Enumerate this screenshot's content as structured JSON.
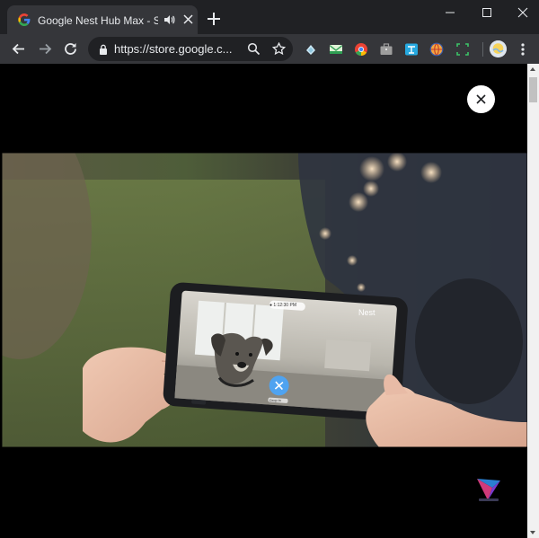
{
  "tab": {
    "title": "Google Nest Hub Max - Sm",
    "favicon": "google-g-icon",
    "audio_icon": "speaker-icon",
    "close_icon": "close-icon"
  },
  "window_controls": [
    "minimize-icon",
    "maximize-icon",
    "close-icon"
  ],
  "toolbar": {
    "url": "https://store.google.c...",
    "nav_icons": [
      "back-arrow-icon",
      "forward-arrow-icon",
      "reload-icon"
    ],
    "omnibox_icons": [
      "lock-icon",
      "zoom-icon",
      "star-icon"
    ],
    "extensions": [
      "extension-feedly-icon",
      "extension-mail-icon",
      "extension-chrome-icon",
      "extension-briefcase-icon",
      "extension-translate-icon",
      "extension-globe-icon",
      "extension-screenshot-icon"
    ],
    "profile": "profile-avatar",
    "menu_icon": "kebab-menu-icon"
  },
  "video_overlay": {
    "phone_brand": "Nest",
    "phone_time_chip": "● 1:12:30 PM",
    "phone_button_caption": "Drop in"
  },
  "colors": {
    "tabstrip": "#202124",
    "toolbar": "#35363a",
    "page_background": "#000000",
    "accent_blue": "#4fa3f0"
  }
}
